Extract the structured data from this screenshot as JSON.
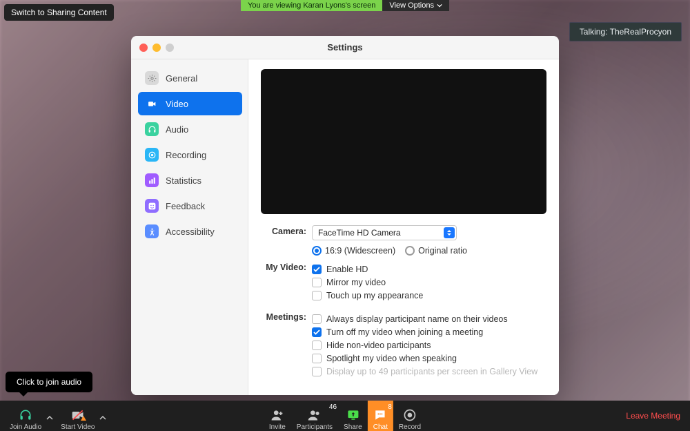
{
  "top": {
    "switch_share": "Switch to Sharing Content",
    "viewing_screen": "You are viewing Karan Lyons's screen",
    "view_options": "View Options",
    "talking_label": "Talking:",
    "talking_name": "TheRealProcyon"
  },
  "settings": {
    "title": "Settings",
    "sidebar": [
      {
        "label": "General",
        "icon": "gear",
        "color": "#d9d9d9",
        "fg": "#888"
      },
      {
        "label": "Video",
        "icon": "camera",
        "color": "#0e72ed",
        "fg": "#fff",
        "active": true
      },
      {
        "label": "Audio",
        "icon": "headphones",
        "color": "#3ad29f",
        "fg": "#fff"
      },
      {
        "label": "Recording",
        "icon": "record",
        "color": "#2ab6f6",
        "fg": "#fff"
      },
      {
        "label": "Statistics",
        "icon": "stats",
        "color": "#a05cff",
        "fg": "#fff"
      },
      {
        "label": "Feedback",
        "icon": "smile",
        "color": "#8f6dff",
        "fg": "#fff"
      },
      {
        "label": "Accessibility",
        "icon": "access",
        "color": "#5a8dff",
        "fg": "#fff"
      }
    ],
    "camera": {
      "label": "Camera:",
      "selected": "FaceTime HD Camera",
      "aspect": {
        "widescreen": "16:9 (Widescreen)",
        "original": "Original ratio",
        "value": "widescreen"
      }
    },
    "my_video": {
      "label": "My Video:",
      "options": [
        {
          "text": "Enable HD",
          "checked": true
        },
        {
          "text": "Mirror my video",
          "checked": false
        },
        {
          "text": "Touch up my appearance",
          "checked": false
        }
      ]
    },
    "meetings": {
      "label": "Meetings:",
      "options": [
        {
          "text": "Always display participant name on their videos",
          "checked": false
        },
        {
          "text": "Turn off my video when joining a meeting",
          "checked": true
        },
        {
          "text": "Hide non-video participants",
          "checked": false
        },
        {
          "text": "Spotlight my video when speaking",
          "checked": false
        },
        {
          "text": "Display up to 49 participants per screen in Gallery View",
          "checked": false,
          "disabled": true
        }
      ]
    }
  },
  "tooltip": {
    "join_audio": "Click to join audio"
  },
  "toolbar": {
    "join_audio": "Join Audio",
    "start_video": "Start Video",
    "invite": "Invite",
    "participants": "Participants",
    "participants_count": "46",
    "share": "Share",
    "chat": "Chat",
    "chat_count": "8",
    "record": "Record",
    "leave": "Leave Meeting"
  }
}
